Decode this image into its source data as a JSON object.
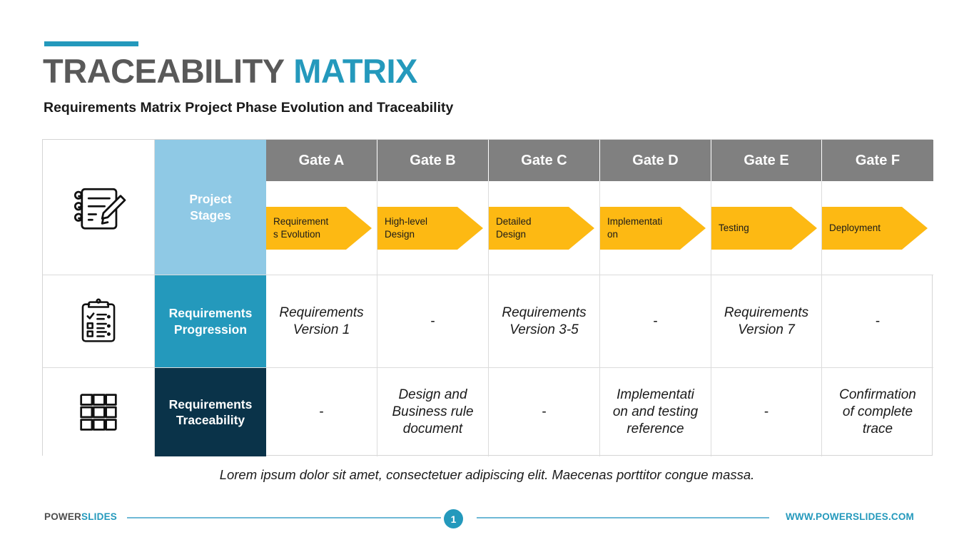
{
  "title": {
    "part1": "TRACEABILITY",
    "part2": "MATRIX",
    "accent_color": "#2499BC",
    "gray_color": "#595959"
  },
  "subtitle": "Requirements Matrix Project Phase Evolution and Traceability",
  "table": {
    "gate_headers": [
      "Gate A",
      "Gate B",
      "Gate C",
      "Gate D",
      "Gate E",
      "Gate F"
    ],
    "header_bg": "#808080",
    "rows": [
      {
        "label": "Project\nStages",
        "label_line1": "Project",
        "label_line2": "Stages",
        "panel_color": "#8FC9E5",
        "icon": "notepad-pencil-icon",
        "type": "arrows",
        "cells": [
          "Requirement\ns Evolution",
          "High-level\nDesign",
          "Detailed\nDesign",
          "Implementati\non",
          "Testing",
          "Deployment"
        ],
        "arrow_color": "#FDB913"
      },
      {
        "label_line1": "Requirements",
        "label_line2": "Progression",
        "panel_color": "#2499BC",
        "icon": "clipboard-checklist-icon",
        "type": "text",
        "cells": [
          "Requirements\nVersion 1",
          "-",
          "Requirements\nVersion 3-5",
          "-",
          "Requirements\nVersion 7",
          "-"
        ]
      },
      {
        "label_line1": "Requirements",
        "label_line2": "Traceability",
        "panel_color": "#0A3349",
        "icon": "matrix-grid-icon",
        "type": "text",
        "cells": [
          "-",
          "Design and\nBusiness rule\ndocument",
          "-",
          "Implementati\non and testing\nreference",
          "-",
          "Confirmation\nof complete\ntrace"
        ]
      }
    ]
  },
  "caption": "Lorem ipsum dolor sit amet, consectetuer adipiscing elit. Maecenas porttitor congue massa.",
  "footer": {
    "brand_part1": "POWER",
    "brand_part2": "SLIDES",
    "page_number": "1",
    "website": "WWW.POWERSLIDES.COM"
  }
}
